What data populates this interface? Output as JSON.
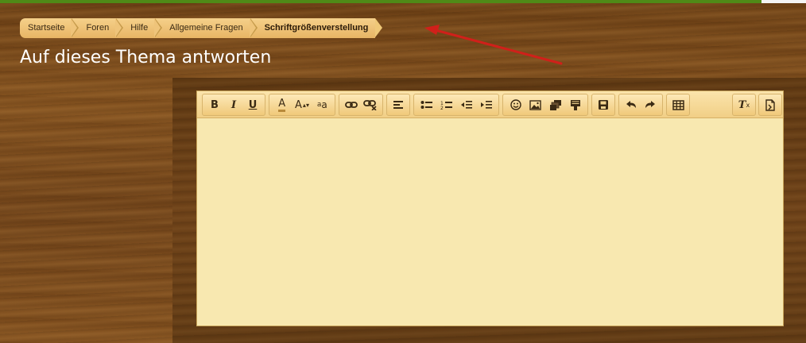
{
  "breadcrumb": {
    "items": [
      {
        "label": "Startseite"
      },
      {
        "label": "Foren"
      },
      {
        "label": "Hilfe"
      },
      {
        "label": "Allgemeine Fragen"
      },
      {
        "label": "Schriftgrößenverstellung"
      }
    ]
  },
  "page": {
    "title": "Auf dieses Thema antworten"
  },
  "editor": {
    "toolbar": {
      "bold_label": "B",
      "italic_label": "I",
      "underline_label": "U",
      "font_color_label": "A",
      "font_size_label": "A",
      "font_name_label": "a",
      "remove_format_label": "T"
    },
    "content": ""
  },
  "colors": {
    "annotation_arrow": "#d0201a",
    "top_bar": "#4f8a17",
    "editor_background": "#f8e8b0"
  }
}
